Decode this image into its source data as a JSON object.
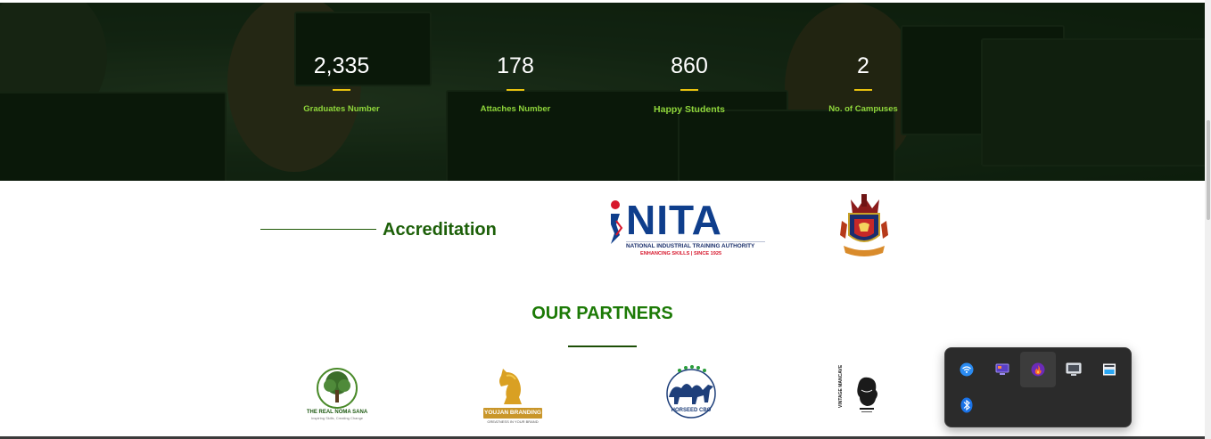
{
  "stats": [
    {
      "number": "2,335",
      "label": "Graduates Number"
    },
    {
      "number": "178",
      "label": "Attaches Number"
    },
    {
      "number": "860",
      "label": "Happy Students"
    },
    {
      "number": "2",
      "label": "No. of Campuses"
    }
  ],
  "accreditation": {
    "title": "Accreditation",
    "nita": {
      "wordmark": "iNITA",
      "fullname": "NATIONAL INDUSTRIAL TRAINING AUTHORITY",
      "tagline": "ENHANCING SKILLS | SINCE 1925"
    },
    "crest_icon": "coat-of-arms-icon"
  },
  "partners": {
    "title": "OUR PARTNERS",
    "logos": [
      {
        "name": "THE REAL NOMA SANA",
        "tagline": "Inspiring Skills, Creating Change",
        "icon": "tree-icon"
      },
      {
        "name": "YOUJAN BRANDING",
        "tagline": "GREATNESS IN YOUR BRAND",
        "icon": "chess-knight-icon"
      },
      {
        "name": "HORSEED CBO",
        "icon": "camel-icon"
      },
      {
        "name": "VINTAGE MANCAVE",
        "icon": "man-silhouette-icon"
      }
    ]
  },
  "tray": {
    "icons": [
      "wifi-icon",
      "display-icon",
      "fire-app-icon",
      "monitor-icon",
      "window-icon",
      "bluetooth-icon"
    ]
  },
  "colors": {
    "accent_green": "#1c7a06",
    "stat_label_green": "#8fd63b",
    "stat_bar_yellow": "#e8c20e"
  }
}
